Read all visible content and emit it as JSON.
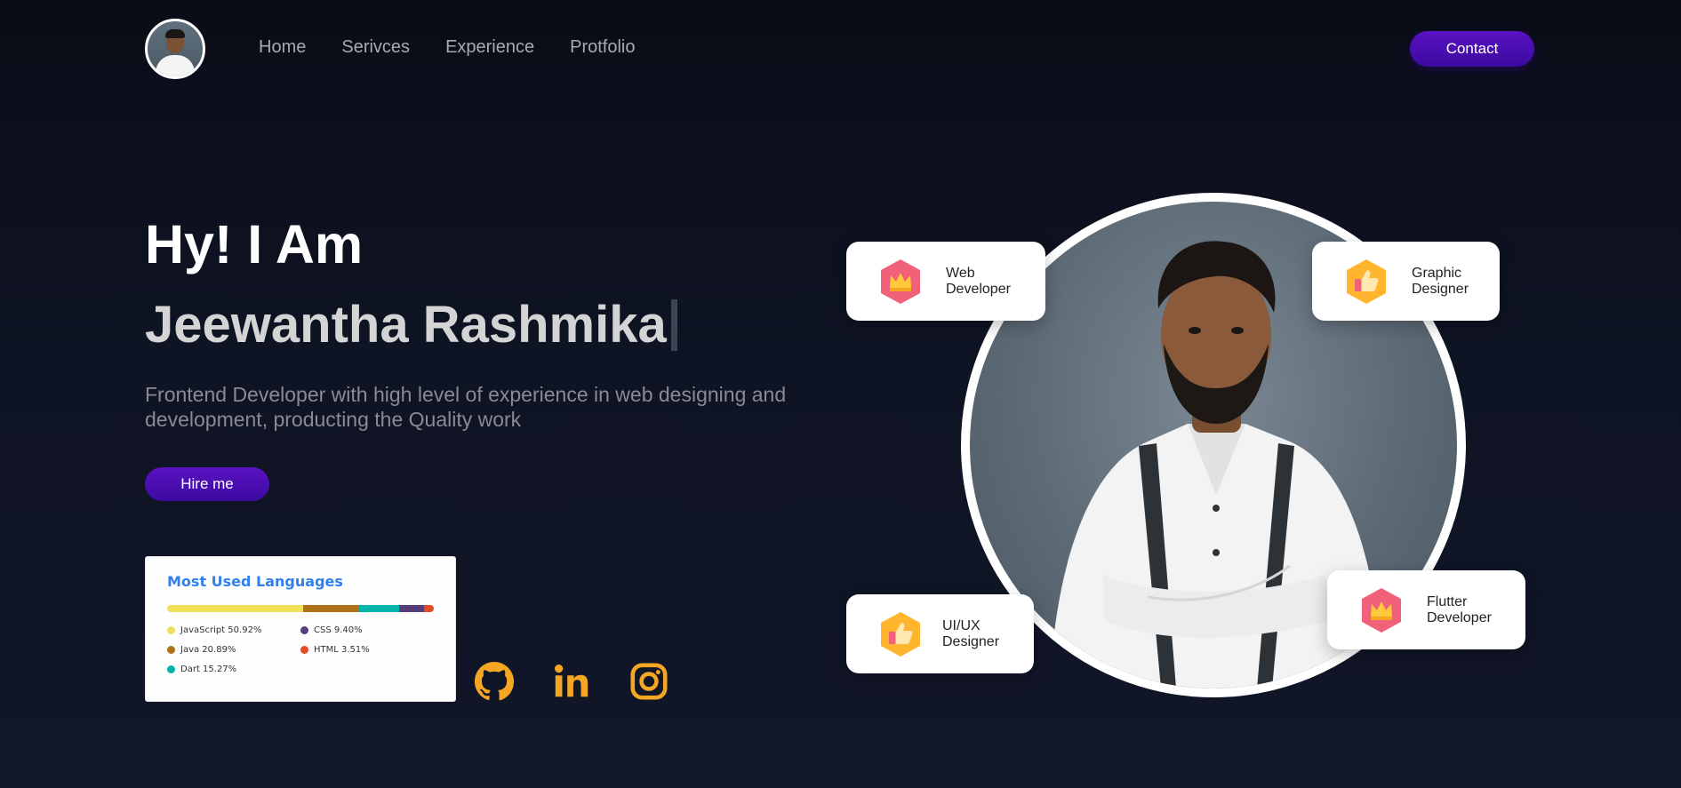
{
  "nav": {
    "links": [
      "Home",
      "Serivces",
      "Experience",
      "Protfolio"
    ],
    "contact_label": "Contact"
  },
  "hero": {
    "greeting": "Hy! I Am",
    "name": "Jeewantha Rashmika",
    "tagline": "Frontend Developer with high level of experience in web designing and development, producting the Quality work",
    "hire_label": "Hire me"
  },
  "languages": {
    "title": "Most Used Languages",
    "items": [
      {
        "label": "JavaScript 50.92%",
        "percent": 50.92,
        "color": "#f1e05a"
      },
      {
        "label": "CSS 9.40%",
        "percent": 9.4,
        "color": "#563d7c"
      },
      {
        "label": "Java 20.89%",
        "percent": 20.89,
        "color": "#b07219"
      },
      {
        "label": "HTML 3.51%",
        "percent": 3.51,
        "color": "#e34c26"
      },
      {
        "label": "Dart 15.27%",
        "percent": 15.27,
        "color": "#00b4ab"
      }
    ]
  },
  "social": {
    "icons": [
      "github-icon",
      "linkedin-icon",
      "instagram-icon"
    ],
    "color": "#f5a623"
  },
  "skills": {
    "web": "Web Developer",
    "graphic": "Graphic Designer",
    "uiux": "UI/UX Designer",
    "flutter": "Flutter Developer"
  },
  "colors": {
    "accent": "#4b0fb3",
    "background": "#0f1424"
  }
}
